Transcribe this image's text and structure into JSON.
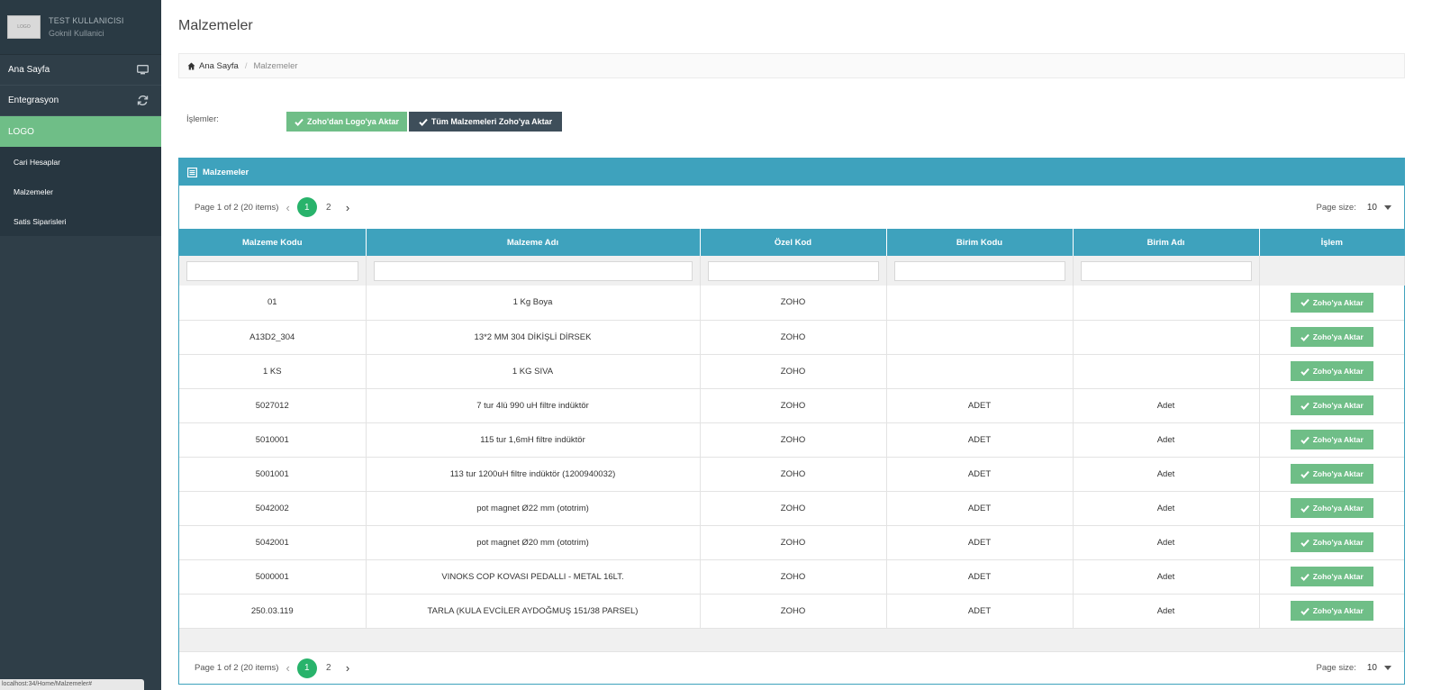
{
  "profile": {
    "avatar_text": "LOGO",
    "name": "TEST KULLANICISI",
    "role": "Goknil Kullanici"
  },
  "sidebar": {
    "items": [
      {
        "label": "Ana Sayfa",
        "icon": "monitor-icon"
      },
      {
        "label": "Entegrasyon",
        "icon": "refresh-icon"
      },
      {
        "label": "LOGO"
      }
    ],
    "subitems": [
      {
        "label": "Cari Hesaplar"
      },
      {
        "label": "Malzemeler"
      },
      {
        "label": "Satis Siparisleri"
      }
    ]
  },
  "status_bar": "localhost:34/Home/Malzemeler#",
  "page": {
    "title": "Malzemeler"
  },
  "breadcrumb": {
    "home": "Ana Sayfa",
    "separator": "/",
    "current": "Malzemeler"
  },
  "operations": {
    "label": "İşlemler:",
    "buttons": {
      "zoho_to_logo": "Zoho'dan Logo'ya Aktar",
      "all_to_zoho": "Tüm Malzemeleri Zoho'ya Aktar"
    }
  },
  "panel": {
    "title": "Malzemeler"
  },
  "pager": {
    "info": "Page 1 of 2 (20 items)",
    "pages": [
      "1",
      "2"
    ],
    "current_page": "1",
    "page_size_label": "Page size:",
    "page_size": "10"
  },
  "table": {
    "columns": [
      "Malzeme Kodu",
      "Malzeme Adı",
      "Özel Kod",
      "Birim Kodu",
      "Birim Adı",
      "İşlem"
    ],
    "action_label": "Zoho'ya Aktar",
    "rows": [
      {
        "code": "01",
        "name": "1 Kg Boya",
        "special": "ZOHO",
        "unit_code": "",
        "unit_name": ""
      },
      {
        "code": "A13D2_304",
        "name": "13*2 MM 304 DİKİŞLİ DİRSEK",
        "special": "ZOHO",
        "unit_code": "",
        "unit_name": ""
      },
      {
        "code": "1 KS",
        "name": "1 KG SIVA",
        "special": "ZOHO",
        "unit_code": "",
        "unit_name": ""
      },
      {
        "code": "5027012",
        "name": "7 tur 4lü 990 uH filtre indüktör",
        "special": "ZOHO",
        "unit_code": "ADET",
        "unit_name": "Adet"
      },
      {
        "code": "5010001",
        "name": "115 tur 1,6mH filtre indüktör",
        "special": "ZOHO",
        "unit_code": "ADET",
        "unit_name": "Adet"
      },
      {
        "code": "5001001",
        "name": "113 tur 1200uH filtre indüktör (1200940032)",
        "special": "ZOHO",
        "unit_code": "ADET",
        "unit_name": "Adet"
      },
      {
        "code": "5042002",
        "name": "pot magnet Ø22 mm (ototrim)",
        "special": "ZOHO",
        "unit_code": "ADET",
        "unit_name": "Adet"
      },
      {
        "code": "5042001",
        "name": "pot magnet Ø20 mm (ototrim)",
        "special": "ZOHO",
        "unit_code": "ADET",
        "unit_name": "Adet"
      },
      {
        "code": "5000001",
        "name": "VINOKS COP KOVASI PEDALLI - METAL 16LT.",
        "special": "ZOHO",
        "unit_code": "ADET",
        "unit_name": "Adet"
      },
      {
        "code": "250.03.119",
        "name": "TARLA (KULA EVCİLER AYDOĞMUŞ 151/38 PARSEL)",
        "special": "ZOHO",
        "unit_code": "ADET",
        "unit_name": "Adet"
      }
    ]
  },
  "colors": {
    "accent_blue": "#3ea2bd",
    "green": "#6fbe87",
    "sidebar": "#2f3e48",
    "page_active": "#28b36b",
    "dark_button": "#3e4e5a"
  }
}
